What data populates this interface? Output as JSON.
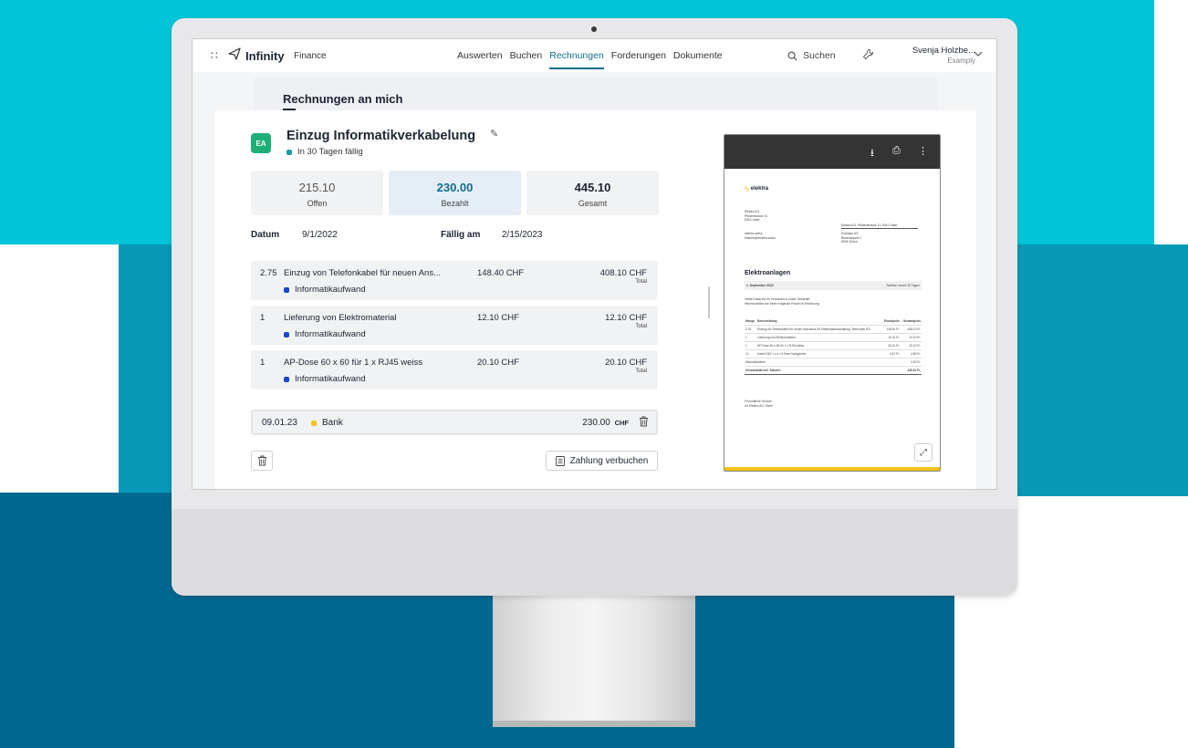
{
  "nav": {
    "brand": "Infinity",
    "product": "Finance",
    "menu": [
      {
        "label": "Auswerten"
      },
      {
        "label": "Buchen"
      },
      {
        "label": "Rechnungen"
      },
      {
        "label": "Forderungen"
      },
      {
        "label": "Dokumente"
      }
    ],
    "active_menu": "Rechnungen",
    "search_label": "Suchen",
    "user_name": "Svenja Holzbe...",
    "user_org": "Examply"
  },
  "section": {
    "title": "Rechnungen an mich"
  },
  "invoice": {
    "avatar": "EA",
    "title": "Einzug Informatikverkabelung",
    "due_status": "In 30 Tagen fällig",
    "stats": {
      "open_value": "215.10",
      "open_label": "Offen",
      "paid_value": "230.00",
      "paid_label": "Bezahlt",
      "total_value": "445.10",
      "total_label": "Gesamt"
    },
    "date_label": "Datum",
    "date_value": "9/1/2022",
    "due_label": "Fällig am",
    "due_value": "2/15/2023",
    "items": [
      {
        "qty": "2.75",
        "desc": "Einzug von Telefonkabel für neuen Ans...",
        "price": "148.40 CHF",
        "total": "408.10 CHF",
        "total_label": "Total",
        "category": "Informatikaufwand"
      },
      {
        "qty": "1",
        "desc": "Lieferung von Elektromaterial",
        "price": "12.10 CHF",
        "total": "12.10 CHF",
        "total_label": "Total",
        "category": "Informatikaufwand"
      },
      {
        "qty": "1",
        "desc": "AP-Dose 60 x 60 für 1 x RJ45 weiss",
        "price": "20.10 CHF",
        "total": "20.10 CHF",
        "total_label": "Total",
        "category": "Informatikaufwand"
      }
    ],
    "payment": {
      "date": "09.01.23",
      "method": "Bank",
      "amount": "230.00",
      "currency": "CHF"
    },
    "book_button": "Zahlung verbuchen"
  },
  "pdf": {
    "logo": "elektra",
    "sender": [
      "Elektra AG",
      "Pfisterstrasse 11",
      "8310 Uster"
    ],
    "contact": [
      "elektra.swiss",
      "finance@elektra.swiss"
    ],
    "sender_line": "Elektra AG, Pfisterstrasse 11, 8310 Uster",
    "recipient": [
      "Examply AG",
      "Bilnerstrasse 1",
      "8005 Zürich"
    ],
    "doc_title": "Elektroanlagen",
    "date": "1. September 2022",
    "terms": "Zahlbar: innert 30 Tagen",
    "thanks_1": "Vielen Dank für Ihr Vertrauen in unser Geschäft.",
    "thanks_2": "Hiermit stellen wir Ihnen folgende Posten in Rechnung:",
    "headers": [
      "Menge",
      "Beschreibung",
      "Einzelpreis",
      "Gesamtpreis"
    ],
    "rows": [
      {
        "qty": "2.75",
        "desc": "Einzug von Telefonkabel für neuen Anschluss für Telefonalarmschaltung, Teleroutier IFC",
        "unit": "148.40 Fr.",
        "total": "408.10 Fr."
      },
      {
        "qty": "1",
        "desc": "Lieferung von Elektromaterial",
        "unit": "12.10 Fr.",
        "total": "12.10 Fr."
      },
      {
        "qty": "1",
        "desc": "AP-Dose 60 x 60 für 1 x RJ45 weiss",
        "unit": "20.10 Fr.",
        "total": "20.10 Fr."
      },
      {
        "qty": "12",
        "desc": "Kabel G51 1 x n x 0.5mm Halogenfrei",
        "unit": "0.42 Fr.",
        "total": "4.80 Fr."
      }
    ],
    "vat_label": "Mehrwertsteuer",
    "vat_value": "0.00 Fr.",
    "sum_label": "Gesamttotal inkl. Steuern",
    "sum_value": "445.10 Fr.",
    "greeting_1": "Freundliche Grüsse,",
    "greeting_2": "Ihr Elektra AG-Team"
  }
}
